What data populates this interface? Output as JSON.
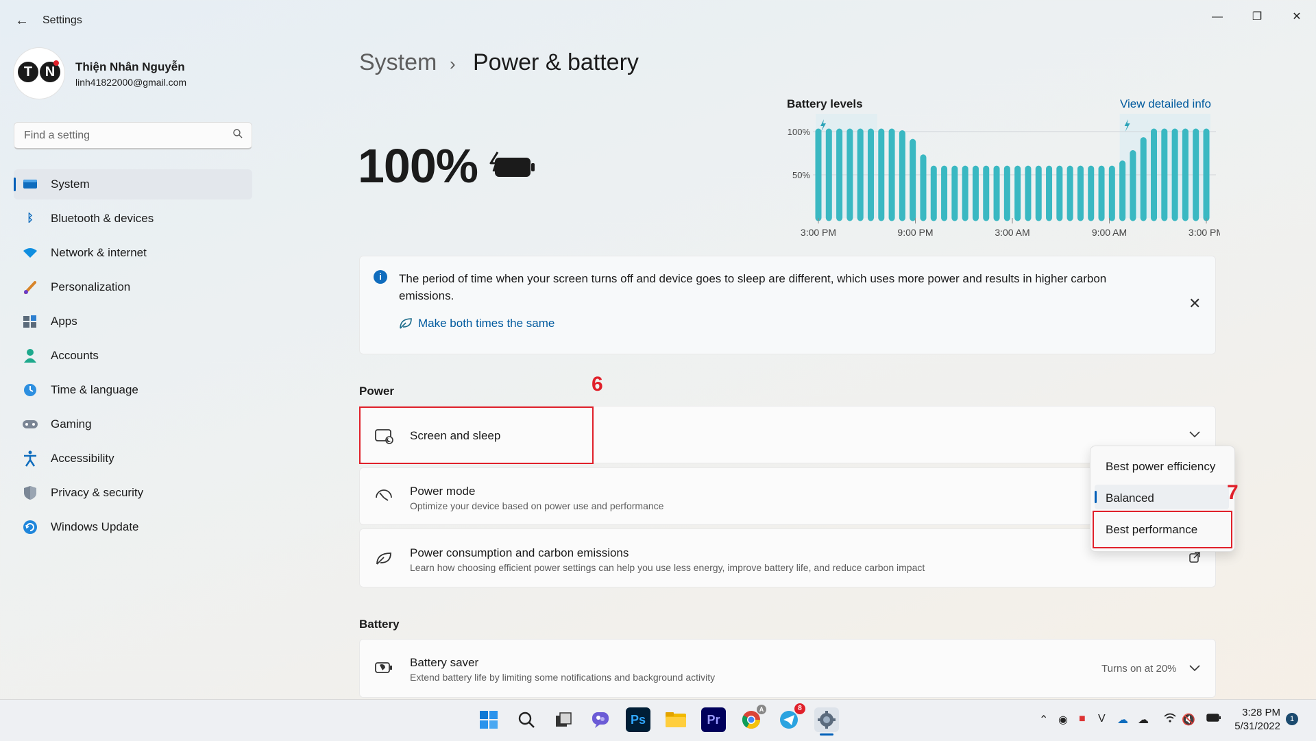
{
  "window": {
    "title": "Settings"
  },
  "user": {
    "initials": [
      "T",
      "N"
    ],
    "name": "Thiện Nhân Nguyễn",
    "email": "linh41822000@gmail.com"
  },
  "search": {
    "placeholder": "Find a setting"
  },
  "sidebar": {
    "items": [
      {
        "label": "System",
        "icon": "system-icon",
        "active": true
      },
      {
        "label": "Bluetooth & devices",
        "icon": "bluetooth-icon"
      },
      {
        "label": "Network & internet",
        "icon": "network-icon"
      },
      {
        "label": "Personalization",
        "icon": "brush-icon"
      },
      {
        "label": "Apps",
        "icon": "apps-icon"
      },
      {
        "label": "Accounts",
        "icon": "accounts-icon"
      },
      {
        "label": "Time & language",
        "icon": "time-icon"
      },
      {
        "label": "Gaming",
        "icon": "gaming-icon"
      },
      {
        "label": "Accessibility",
        "icon": "accessibility-icon"
      },
      {
        "label": "Privacy & security",
        "icon": "shield-icon"
      },
      {
        "label": "Windows Update",
        "icon": "update-icon"
      }
    ]
  },
  "breadcrumb": {
    "parent": "System",
    "separator": "›",
    "current": "Power & battery"
  },
  "battery": {
    "percent_text": "100%",
    "percent": 100
  },
  "chart_data": {
    "type": "bar",
    "title": "Battery levels",
    "link": "View detailed info",
    "y_ticks": [
      "100%",
      "50%"
    ],
    "ylim": [
      0,
      100
    ],
    "x_ticks": [
      "3:00 PM",
      "9:00 PM",
      "3:00 AM",
      "9:00 AM",
      "3:00 PM"
    ],
    "values": [
      100,
      100,
      100,
      100,
      100,
      100,
      100,
      100,
      98,
      88,
      70,
      57,
      57,
      57,
      57,
      57,
      57,
      57,
      57,
      57,
      57,
      57,
      57,
      57,
      57,
      57,
      57,
      57,
      57,
      63,
      75,
      90,
      100,
      100,
      100,
      100,
      100,
      100
    ],
    "charging_markers": [
      "charging",
      "charging"
    ],
    "accent": "#3ab8c2"
  },
  "info": {
    "text": "The period of time when your screen turns off and device goes to sleep are different, which uses more power and results in higher carbon emissions.",
    "link": "Make both times the same"
  },
  "power": {
    "section": "Power",
    "screen_sleep": "Screen and sleep",
    "power_mode_title": "Power mode",
    "power_mode_sub": "Optimize your device based on power use and performance",
    "consumption_title": "Power consumption and carbon emissions",
    "consumption_sub": "Learn how choosing efficient power settings can help you use less energy, improve battery life, and reduce carbon impact"
  },
  "power_mode_menu": {
    "options": [
      "Best power efficiency",
      "Balanced",
      "Best performance"
    ],
    "selected": "Balanced"
  },
  "annotations": {
    "step6": "6",
    "step7": "7"
  },
  "battery_section": {
    "section": "Battery",
    "saver_title": "Battery saver",
    "saver_sub": "Extend battery life by limiting some notifications and background activity",
    "saver_status": "Turns on at 20%"
  },
  "taskbar": {
    "apps": [
      "start-icon",
      "search-icon",
      "task-view-icon",
      "chat-icon",
      "photoshop-icon",
      "file-explorer-icon",
      "premiere-icon",
      "chrome-icon",
      "telegram-icon",
      "settings-icon"
    ],
    "ps_label": "Ps",
    "pr_label": "Pr",
    "telegram_badge": "8",
    "chrome_badge": "A",
    "time": "3:28 PM",
    "date": "5/31/2022",
    "notification_count": "1"
  }
}
